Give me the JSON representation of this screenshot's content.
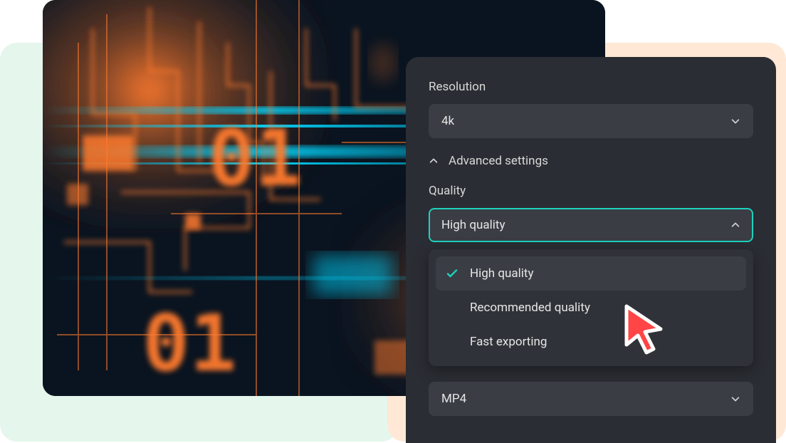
{
  "panel": {
    "resolution_label": "Resolution",
    "resolution_value": "4k",
    "advanced_label": "Advanced settings",
    "quality_label": "Quality",
    "quality_value": "High quality",
    "quality_options": [
      "High quality",
      "Recommended quality",
      "Fast exporting"
    ],
    "quality_selected_index": 0,
    "format_value": "MP4"
  },
  "colors": {
    "panel_bg": "#2a2d33",
    "field_bg": "#3a3d44",
    "accent": "#1dd1bf",
    "cursor_fill": "#ff4545",
    "mint": "#e5f6ed",
    "peach": "#ffe8d5"
  }
}
